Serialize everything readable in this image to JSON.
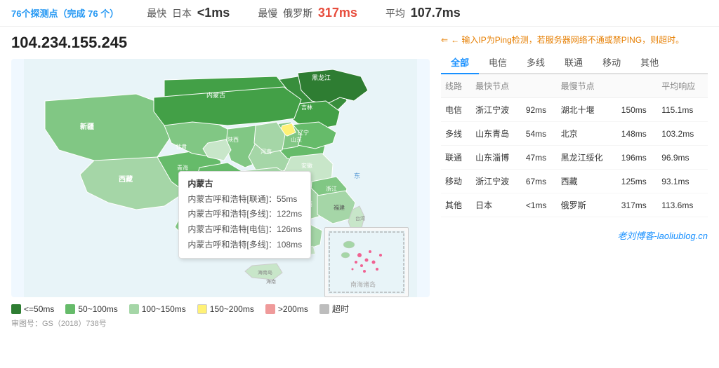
{
  "topbar": {
    "count_label": "76个探测点（完成",
    "count_number": "76",
    "count_suffix": "个）",
    "fastest_label": "最快",
    "fastest_location": "日本",
    "fastest_value": "<1ms",
    "slowest_label": "最慢",
    "slowest_location": "俄罗斯",
    "slowest_value": "317ms",
    "avg_label": "平均",
    "avg_value": "107.7ms"
  },
  "ip": "104.234.155.245",
  "hint": "← 输入IP为Ping检测，若服务器网络不通或禁PING，则超时。",
  "tabs": [
    "全部",
    "电信",
    "多线",
    "联通",
    "移动",
    "其他"
  ],
  "active_tab": 0,
  "table": {
    "headers": [
      "线路",
      "最快节点",
      "",
      "最慢节点",
      "",
      "平均响应"
    ],
    "rows": [
      {
        "line": "电信",
        "fastest_node": "浙江宁波",
        "fastest_val": "92ms",
        "slowest_node": "湖北十堰",
        "slowest_val": "150ms",
        "avg": "115.1ms"
      },
      {
        "line": "多线",
        "fastest_node": "山东青岛",
        "fastest_val": "54ms",
        "slowest_node": "北京",
        "slowest_val": "148ms",
        "avg": "103.2ms"
      },
      {
        "line": "联通",
        "fastest_node": "山东淄博",
        "fastest_val": "47ms",
        "slowest_node": "黑龙江绥化",
        "slowest_val": "196ms",
        "avg": "96.9ms"
      },
      {
        "line": "移动",
        "fastest_node": "浙江宁波",
        "fastest_val": "67ms",
        "slowest_node": "西藏",
        "slowest_val": "125ms",
        "avg": "93.1ms"
      },
      {
        "line": "其他",
        "fastest_node": "日本",
        "fastest_val": "<1ms",
        "slowest_node": "俄罗斯",
        "slowest_val": "317ms",
        "avg": "113.6ms"
      }
    ]
  },
  "legend": [
    {
      "color": "#2e7d32",
      "label": "<=50ms"
    },
    {
      "color": "#66bb6a",
      "label": "50~100ms"
    },
    {
      "color": "#a5d6a7",
      "label": "100~150ms"
    },
    {
      "color": "#fff176",
      "label": "150~200ms"
    },
    {
      "color": "#ef9a9a",
      "label": ">200ms"
    },
    {
      "color": "#bdbdbd",
      "label": "超时"
    }
  ],
  "map_note": "审图号：GS（2018）738号",
  "tooltip": {
    "title": "内蒙古",
    "lines": [
      "内蒙古呼和浩特[联通]：55ms",
      "内蒙古呼和浩特[多线]：122ms",
      "内蒙古呼和浩特[电信]：126ms",
      "内蒙古呼和浩特[多线]：108ms"
    ]
  },
  "minimap_label": "南海诸岛",
  "brand": "老刘博客-laoliublog.cn"
}
